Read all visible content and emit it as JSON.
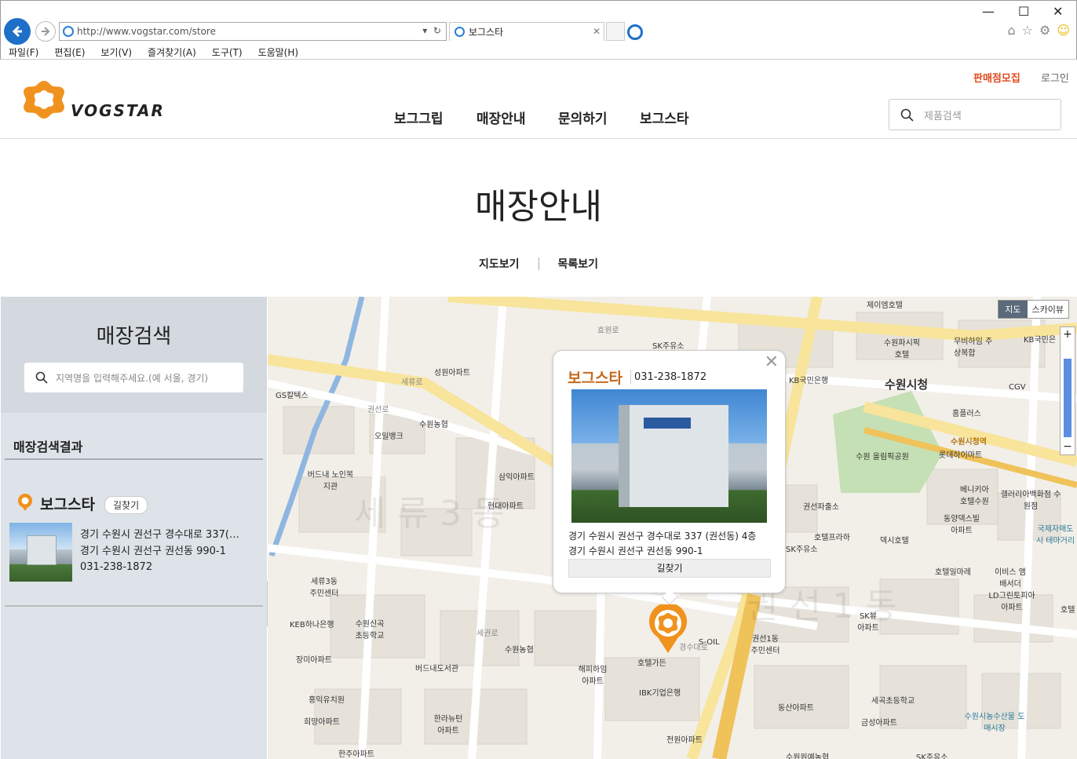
{
  "browser": {
    "url": "http://www.vogstar.com/store",
    "tab_title": "보그스타",
    "menu": [
      "파일(F)",
      "편집(E)",
      "보기(V)",
      "즐겨찾기(A)",
      "도구(T)",
      "도움말(H)"
    ]
  },
  "header": {
    "logo_text": "VOGSTAR",
    "nav": [
      "보그그립",
      "매장안내",
      "문의하기",
      "보그스타"
    ],
    "top_links": {
      "recruit": "판매점모집",
      "login": "로그인"
    },
    "search_placeholder": "제품검색"
  },
  "page": {
    "title": "매장안내",
    "view_map": "지도보기",
    "view_list": "목록보기"
  },
  "sidebar": {
    "title": "매장검색",
    "search_placeholder": "지역명을 입력해주세요.(예 서울, 경기)",
    "result_title": "매장검색결과",
    "store": {
      "name": "보그스타",
      "directions": "길찾기",
      "address_road": "경기 수원시 권선구 경수대로 337(…",
      "address_lot": "경기 수원시 권선구 권선동 990-1",
      "phone": "031-238-1872"
    },
    "collapse": "<"
  },
  "map": {
    "type_map": "지도",
    "type_sky": "스카이뷰",
    "zoom_in": "+",
    "zoom_out": "−",
    "watermark1": "세류3동",
    "watermark2": "권선1동",
    "labels": [
      {
        "text": "제이엠호텔"
      },
      {
        "text": "SK주유소"
      },
      {
        "text": "수원파시픽 호텔"
      },
      {
        "text": "무비하임 주상복합"
      },
      {
        "text": "KB국민은"
      },
      {
        "text": "성원아파트"
      },
      {
        "text": "GS칼텍스"
      },
      {
        "text": "KB국민은행"
      },
      {
        "text": "수원시청"
      },
      {
        "text": "CGV"
      },
      {
        "text": "수원농협"
      },
      {
        "text": "오일뱅크"
      },
      {
        "text": "홈플러스"
      },
      {
        "text": "버드내 노인복지관"
      },
      {
        "text": "삼익아파트"
      },
      {
        "text": "수원 올림픽공원"
      },
      {
        "text": "롯데하이마트"
      },
      {
        "text": "현대아파트"
      },
      {
        "text": "권선파출소"
      },
      {
        "text": "베니키아 호텔수원"
      },
      {
        "text": "갤러리아백화점 수원점"
      },
      {
        "text": "동양덱스빌 아파트"
      },
      {
        "text": "호텔프라하"
      },
      {
        "text": "국제자매도시 테마거리"
      },
      {
        "text": "SK주유소"
      },
      {
        "text": "덱시호텔"
      },
      {
        "text": "세류3동 주민센터"
      },
      {
        "text": "호텔일마레"
      },
      {
        "text": "이비스 앰배서더"
      },
      {
        "text": "LD그린토피아 아파트"
      },
      {
        "text": "KEB하나은행"
      },
      {
        "text": "수원신곡 초등학교"
      },
      {
        "text": "SK뷰 아파트"
      },
      {
        "text": "호텔"
      },
      {
        "text": "장미아파트"
      },
      {
        "text": "수원농협"
      },
      {
        "text": "S-OIL"
      },
      {
        "text": "권선1동 주민센터"
      },
      {
        "text": "버드내도서관"
      },
      {
        "text": "해피하임 아파트"
      },
      {
        "text": "호텔가든"
      },
      {
        "text": "홍익유치원"
      },
      {
        "text": "IBK기업은행"
      },
      {
        "text": "세곡초등학교"
      },
      {
        "text": "희망아파트"
      },
      {
        "text": "동산아파트"
      },
      {
        "text": "한라뉴턴 아파트"
      },
      {
        "text": "금성아파트"
      },
      {
        "text": "수원시농수산물 도매시장"
      },
      {
        "text": "전원아파트"
      },
      {
        "text": "한주아파트"
      },
      {
        "text": "수원원예농협"
      },
      {
        "text": "SK주유소"
      },
      {
        "text": "권선로"
      },
      {
        "text": "세권로"
      },
      {
        "text": "경수대로"
      },
      {
        "text": "세류로"
      },
      {
        "text": "효원로"
      },
      {
        "text": "수원시청역"
      }
    ]
  },
  "infowindow": {
    "name": "보그스타",
    "phone": "031-238-1872",
    "address_road": "경기 수원시 권선구 경수대로 337 (권선동) 4층",
    "address_lot": "경기 수원시 권선구 권선동 990-1",
    "directions": "길찾기",
    "close": "✕"
  },
  "colors": {
    "accent": "#e0491d",
    "brand_orange": "#f0921e",
    "store_name": "#c56a1e"
  }
}
